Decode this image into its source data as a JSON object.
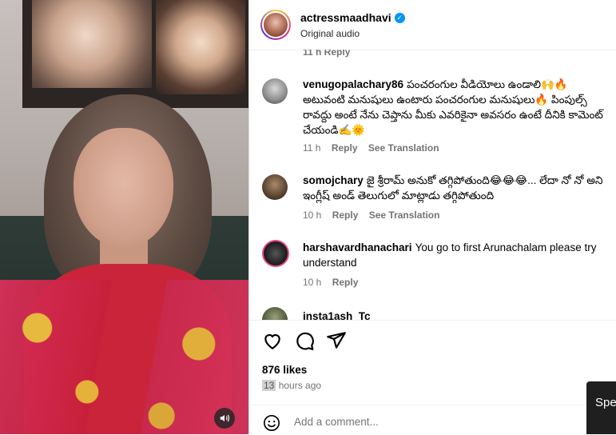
{
  "header": {
    "username": "actressmaadhavi",
    "subtitle": "Original audio"
  },
  "comments": {
    "cut_off_meta": "11 h   Reply",
    "items": [
      {
        "username": "venugopalachary86",
        "text": "పంచరంగుల వీడియోలు ఉండాలి🙌🔥 అటువంటి మనుషులు ఉంటారు పంచరంగుల మనుషులు🔥 పింపుల్స్ రావద్దు అంటే నేను చెప్తాను మీకు ఎవరికైనా అవసరం ఉంటే దీనికి కామెంట్ చేయండి✍️🌞",
        "time": "11 h",
        "reply": "Reply",
        "translate": "See Translation"
      },
      {
        "username": "somojchary",
        "text": "జై శ్రీరామ్ అనుకో తగ్గిపోతుంది😂😂😂... లేదా నో నో అని ఇంగ్లీష్ అండ్ తెలుగులో మాట్లాడు తగ్గిపోతుంది",
        "time": "10 h",
        "reply": "Reply",
        "translate": "See Translation"
      },
      {
        "username": "harshavardhanachari",
        "text": "You go to first Arunachalam please try understand",
        "time": "10 h",
        "reply": "Reply"
      },
      {
        "username": "insta1ash_Tc",
        "text": ""
      }
    ]
  },
  "post": {
    "likes": "876 likes",
    "time_hl": "13",
    "time_rest": " hours ago"
  },
  "composer": {
    "placeholder": "Add a comment..."
  },
  "overlay": {
    "speak_label": "Spe"
  },
  "icons": {
    "like": "heart-icon",
    "comment": "comment-icon",
    "share": "share-icon",
    "emoji": "emoji-icon",
    "sound": "speaker-icon",
    "verified": "verified-badge-icon"
  },
  "colors": {
    "verified": "#0095f6",
    "meta": "#737373"
  }
}
